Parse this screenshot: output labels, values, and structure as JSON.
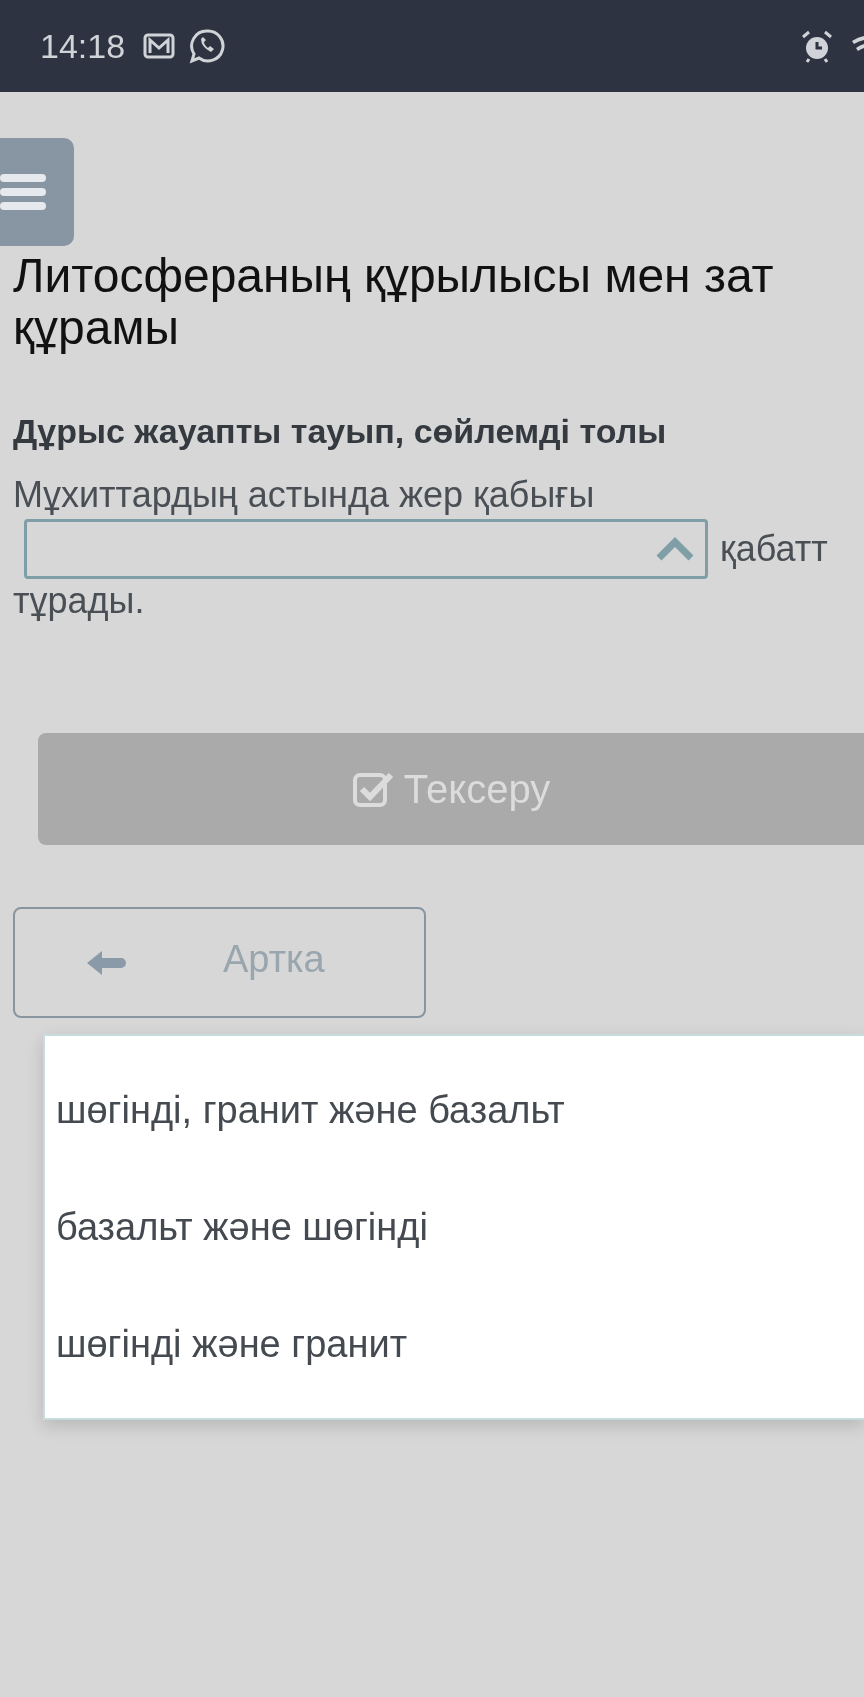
{
  "status_bar": {
    "time": "14:18"
  },
  "menu_button": {
    "kind": "hamburger"
  },
  "title_lines": [
    "Литосфераның құрылысы мен зат",
    "құрамы"
  ],
  "instruction": "Дұрыс жауапты тауып, сөйлемді толы",
  "sentence": {
    "before": "Мұхиттардың астында жер қабығы",
    "after": "қабатт",
    "end": "тұрады."
  },
  "answer_select": {
    "expanded": true,
    "options": [
      {
        "label": "шөгінді, гранит және базальт",
        "selected": false
      },
      {
        "label": "базальт және шөгінді",
        "selected": false
      },
      {
        "label": "шөгінді және гранит",
        "selected": false
      }
    ]
  },
  "check_button": {
    "label": "Тексеру",
    "disabled": true
  },
  "back_button": {
    "label": "Артка"
  }
}
